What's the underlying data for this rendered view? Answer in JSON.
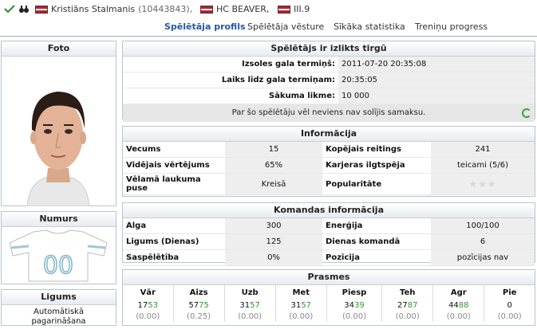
{
  "header": {
    "player_name": "Kristiāns Stalmanis",
    "player_id": "(10443843),",
    "team_name": "HC BEAVER,",
    "league": "III.9"
  },
  "tabs": [
    {
      "label": "Spēlētāja profils",
      "active": true
    },
    {
      "label": "Spēlētāja vēsture"
    },
    {
      "label": "Sīkāka statistika"
    },
    {
      "label": "Treniņu progress"
    }
  ],
  "photo": {
    "title": "Foto"
  },
  "number": {
    "title": "Numurs",
    "value": "00"
  },
  "contract": {
    "title": "Ligums",
    "auto_renew_label": "Automātiskā pagarināšana"
  },
  "auction": {
    "title": "Spēlētājs ir izlikts tirgū",
    "rows": [
      {
        "label": "Izsoles gala termiņš:",
        "value": "2011-07-20 20:35:08"
      },
      {
        "label": "Laiks līdz gala termiņam:",
        "value": "20:35:05"
      },
      {
        "label": "Sākuma likme:",
        "value": "10 000"
      }
    ],
    "note": "Par šo spēlētāju vēl neviens nav solījis samaksu."
  },
  "info": {
    "title": "Informācija",
    "rows": [
      {
        "l1": "Vecums",
        "v1": "15",
        "l2": "Kopējais reitings",
        "v2": "241"
      },
      {
        "l1": "Vidējais vērtējums",
        "v1": "65%",
        "l2": "Karjeras ilgtspēja",
        "v2": "teicami (5/6)"
      },
      {
        "l1": "Vēlamā laukuma puse",
        "v1": "Kreisā",
        "l2": "Popularitāte",
        "v2": ""
      }
    ],
    "popularity_stars": 0
  },
  "team_info": {
    "title": "Komandas informācija",
    "rows": [
      {
        "l1": "Alga",
        "v1": "300",
        "l2": "Enerģija",
        "v2": "100/100"
      },
      {
        "l1": "Ligums (Dienas)",
        "v1": "125",
        "l2": "Dienas komandā",
        "v2": "6"
      },
      {
        "l1": "Saspēlētība",
        "v1": "0%",
        "l2": "Pozīcija",
        "v2": "pozīcijas nav"
      }
    ]
  },
  "skills": {
    "title": "Prasmes",
    "headers": [
      "Vār",
      "Aizs",
      "Uzb",
      "Met",
      "Piesp",
      "Teh",
      "Agr",
      "Pie"
    ],
    "values": [
      {
        "base": "17",
        "plus": "53"
      },
      {
        "base": "57",
        "plus": "75"
      },
      {
        "base": "31",
        "plus": "57"
      },
      {
        "base": "31",
        "plus": "57"
      },
      {
        "base": "34",
        "plus": "39"
      },
      {
        "base": "27",
        "plus": "87"
      },
      {
        "base": "44",
        "plus": "88"
      },
      {
        "base": "0",
        "plus": ""
      }
    ],
    "potential": [
      "(0.00)",
      "(0.25)",
      "(0.00)",
      "(0.00)",
      "(0.00)",
      "(0.00)",
      "(0.00)",
      "(0.00)"
    ]
  }
}
